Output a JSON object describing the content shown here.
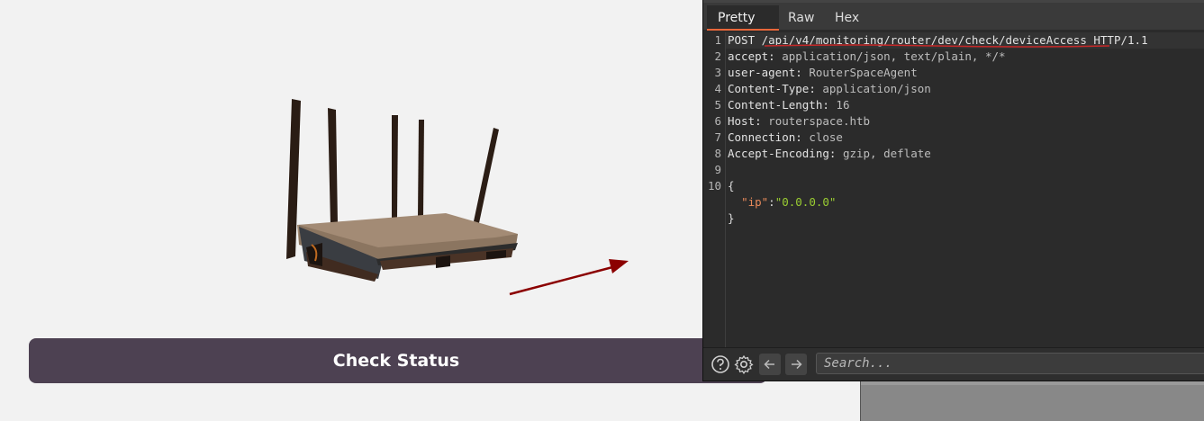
{
  "check_button": {
    "label": "Check Status"
  },
  "tabs": [
    {
      "label": "Pretty",
      "active": true
    },
    {
      "label": "Raw",
      "active": false
    },
    {
      "label": "Hex",
      "active": false
    }
  ],
  "request": {
    "line_numbers": [
      "1",
      "2",
      "3",
      "4",
      "5",
      "6",
      "7",
      "8",
      "9",
      "10"
    ],
    "request_line": "POST /api/v4/monitoring/router/dev/check/deviceAccess HTTP/1.1",
    "headers": [
      {
        "name": "accept",
        "value": "application/json, text/plain, */*"
      },
      {
        "name": "user-agent",
        "value": "RouterSpaceAgent"
      },
      {
        "name": "Content-Type",
        "value": "application/json"
      },
      {
        "name": "Content-Length",
        "value": "16"
      },
      {
        "name": "Host",
        "value": "routerspace.htb"
      },
      {
        "name": "Connection",
        "value": "close"
      },
      {
        "name": "Accept-Encoding",
        "value": "gzip, deflate"
      }
    ],
    "body_open": "{",
    "body_key": "\"ip\"",
    "body_sep": ":",
    "body_value": "\"0.0.0.0\"",
    "body_close": "}"
  },
  "statusbar": {
    "help_icon": "question-circle-icon",
    "settings_icon": "gear-icon",
    "back_icon": "arrow-left-icon",
    "forward_icon": "arrow-right-icon",
    "search_placeholder": "Search..."
  },
  "colors": {
    "button_bg": "#4d4152",
    "panel_bg": "#2b2b2b",
    "tab_accent": "#e8673a",
    "arrow": "#8b0000",
    "json_key": "#e88a5a",
    "json_value": "#9acd32"
  }
}
